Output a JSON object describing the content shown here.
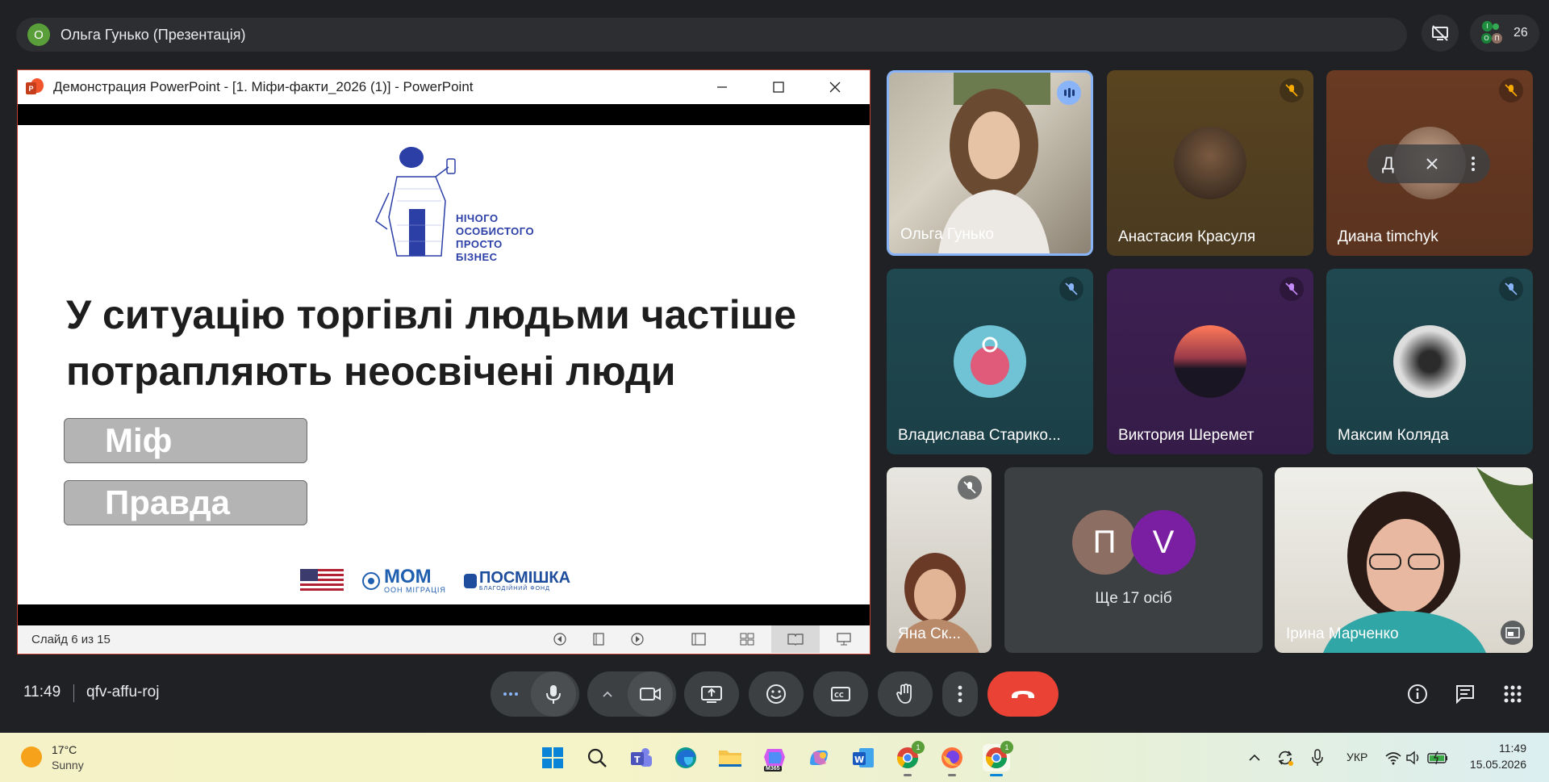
{
  "topbar": {
    "presenter_initial": "О",
    "presenter_label": "Ольга Гунько (Презентація)",
    "people_count": "26",
    "people_initials": [
      "І",
      "О",
      "П"
    ]
  },
  "ppt": {
    "window_title": "Демонстрация PowerPoint - [1. Міфи-факти_2026 (1)] - PowerPoint",
    "slide_info": "Слайд 6 из 15",
    "slide": {
      "heading_line1": "У ситуацію торгівлі людьми частіше",
      "heading_line2": "потрапляють неосвічені люди",
      "answer_1": "Міф",
      "answer_2": "Правда",
      "logo_lines": [
        "НІЧОГО",
        "ОСОБИСТОГО",
        "ПРОСТО",
        "БІЗНЕС"
      ],
      "iom_main": "МОМ",
      "iom_sub": "ООН МІГРАЦІЯ",
      "posmishka_main": "ПОСМІШКА",
      "posmishka_sub": "БЛАГОДІЙНИЙ ФОНД"
    }
  },
  "participants": [
    {
      "name": "Ольга Гунько",
      "speaking": true
    },
    {
      "name": "Анастасия Красуля",
      "muted": true
    },
    {
      "name": "Диана timchyk",
      "muted": true,
      "overlay_letter": "Д"
    },
    {
      "name": "Владислава Старико...",
      "muted": true
    },
    {
      "name": "Виктория Шеремет",
      "muted": true
    },
    {
      "name": "Максим Коляда",
      "muted": true
    },
    {
      "name": "Яна Ск...",
      "muted": true
    },
    {
      "name": "Ірина Марченко"
    }
  ],
  "others_tile": {
    "avatar_1": "П",
    "avatar_2": "V",
    "label": "Ще 17 осіб"
  },
  "controls": {
    "time": "11:49",
    "meeting_code": "qfv-affu-roj"
  },
  "taskbar": {
    "temperature": "17°C",
    "weather": "Sunny",
    "language": "УКР",
    "time": "11:49",
    "date": "15.05.2026",
    "chrome_badge": "1",
    "m365_label": "M365"
  },
  "colors": {
    "meet_bg": "#202124",
    "end_call": "#ea4335",
    "ppt_border": "#c2402e",
    "speaking_border": "#8ab4f8"
  }
}
